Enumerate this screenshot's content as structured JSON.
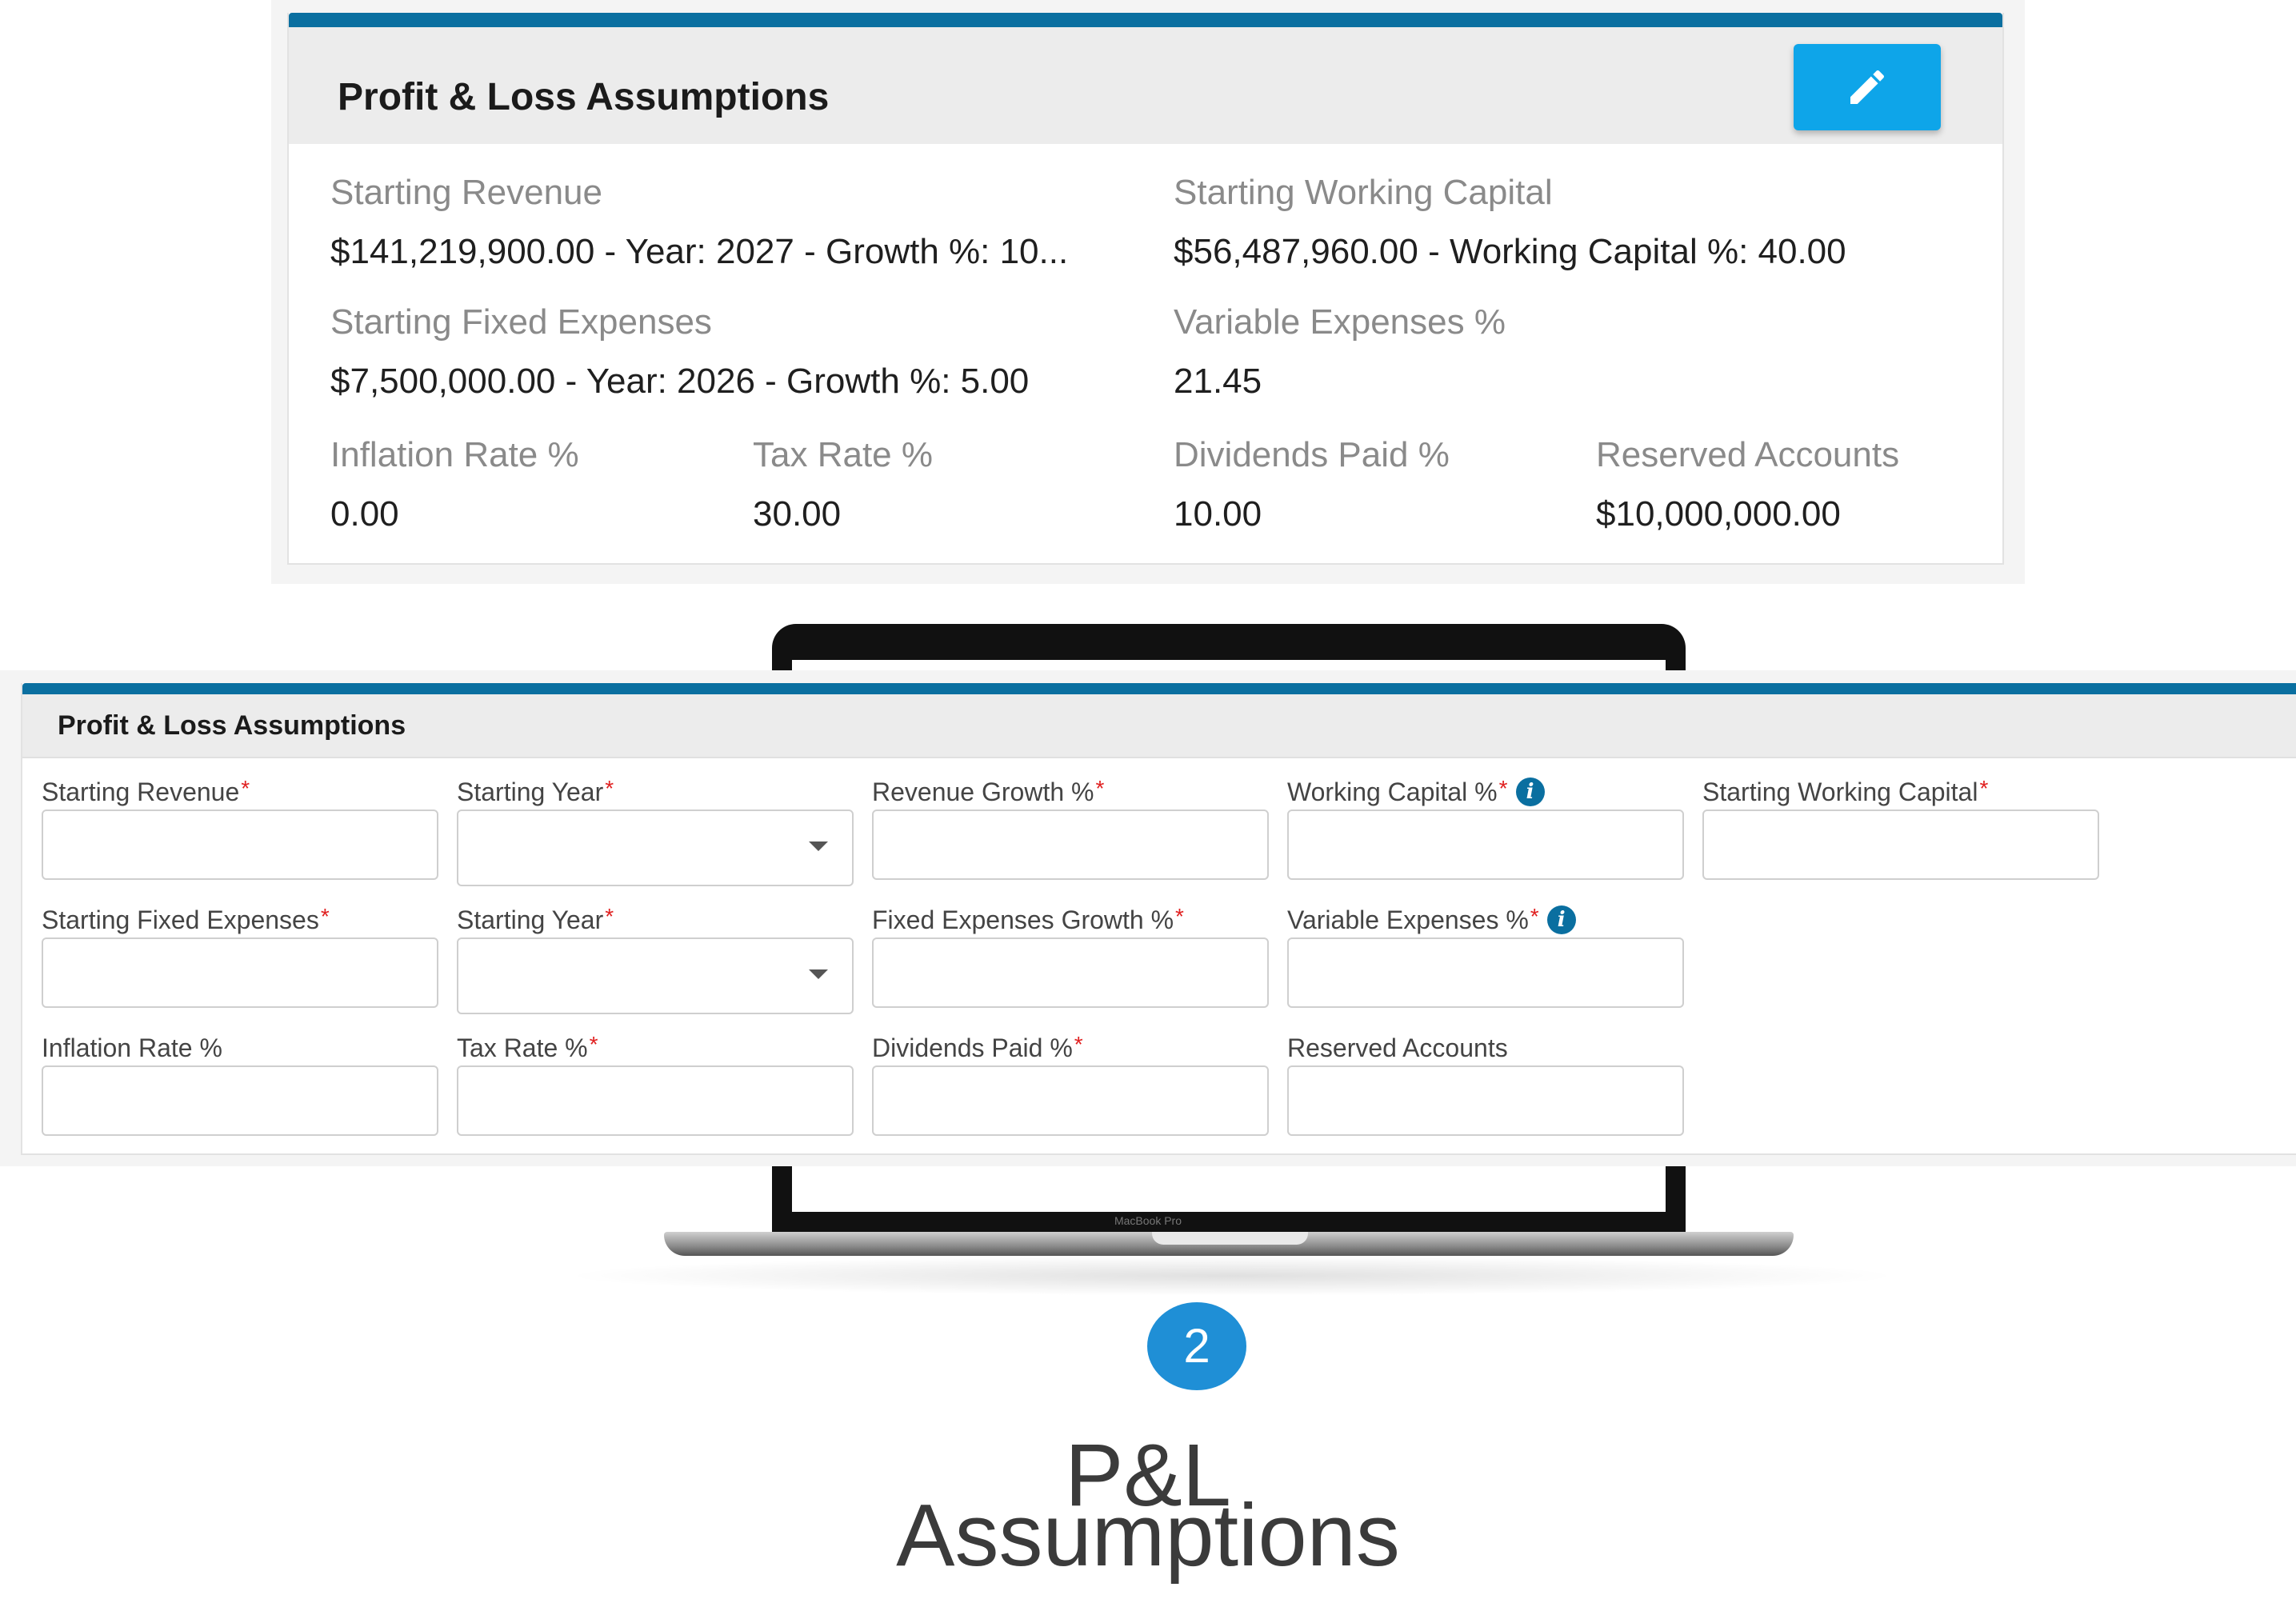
{
  "summary": {
    "title": "Profit & Loss Assumptions",
    "edit_icon": "pencil-icon",
    "fields": {
      "starting_revenue": {
        "label": "Starting Revenue",
        "value": "$141,219,900.00 - Year: 2027 - Growth %: 10..."
      },
      "starting_working_capital": {
        "label": "Starting Working Capital",
        "value": "$56,487,960.00 - Working Capital %: 40.00"
      },
      "starting_fixed_expenses": {
        "label": "Starting Fixed Expenses",
        "value": "$7,500,000.00 - Year: 2026 - Growth %: 5.00"
      },
      "variable_expenses": {
        "label": "Variable Expenses %",
        "value": "21.45"
      },
      "inflation_rate": {
        "label": "Inflation Rate %",
        "value": "0.00"
      },
      "tax_rate": {
        "label": "Tax Rate %",
        "value": "30.00"
      },
      "dividends_paid": {
        "label": "Dividends Paid %",
        "value": "10.00"
      },
      "reserved_accounts": {
        "label": "Reserved Accounts",
        "value": "$10,000,000.00"
      }
    }
  },
  "laptop": {
    "brand": "MacBook Pro"
  },
  "form": {
    "title": "Profit & Loss Assumptions",
    "required_mark": "*",
    "info_glyph": "i",
    "fields": {
      "starting_revenue": {
        "label": "Starting Revenue",
        "value": ""
      },
      "starting_year_1": {
        "label": "Starting Year",
        "value": ""
      },
      "revenue_growth": {
        "label": "Revenue Growth %",
        "value": ""
      },
      "working_capital_pct": {
        "label": "Working Capital %",
        "value": ""
      },
      "starting_working_capital": {
        "label": "Starting Working Capital",
        "value": ""
      },
      "starting_fixed_expenses": {
        "label": "Starting Fixed Expenses",
        "value": ""
      },
      "starting_year_2": {
        "label": "Starting Year",
        "value": ""
      },
      "fixed_expenses_growth": {
        "label": "Fixed Expenses Growth %",
        "value": ""
      },
      "variable_expenses": {
        "label": "Variable Expenses %",
        "value": ""
      },
      "inflation_rate": {
        "label": "Inflation Rate %",
        "value": ""
      },
      "tax_rate": {
        "label": "Tax Rate %",
        "value": ""
      },
      "dividends_paid": {
        "label": "Dividends Paid %",
        "value": ""
      },
      "reserved_accounts": {
        "label": "Reserved Accounts",
        "value": ""
      }
    }
  },
  "step": {
    "number": "2",
    "title_line1": "P&L",
    "title_line2": "Assumptions"
  },
  "colors": {
    "accent": "#0a6fa0",
    "button": "#0ea5e9",
    "badge": "#1f8fd6",
    "required": "#e02020"
  }
}
